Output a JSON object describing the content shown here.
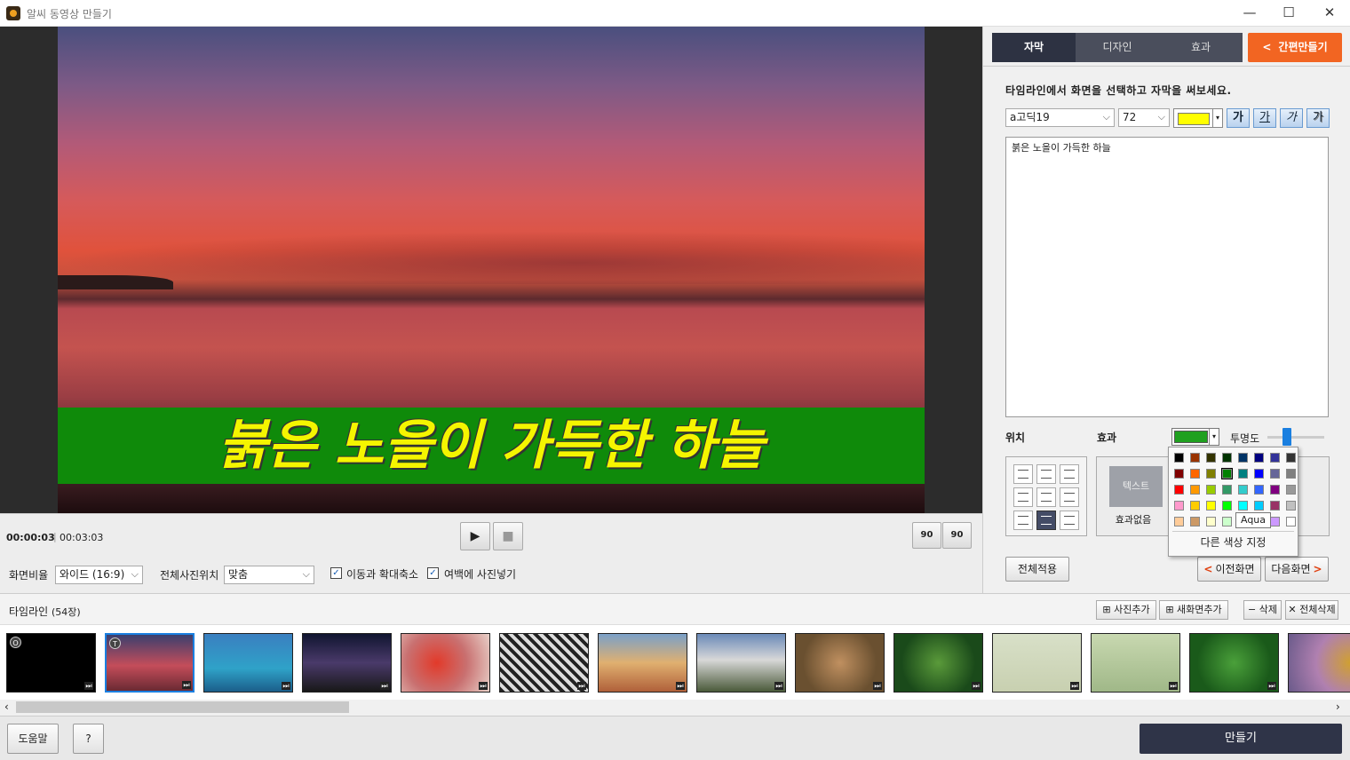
{
  "window": {
    "title": "알씨 동영상 만들기",
    "minimize": "—",
    "maximize": "☐",
    "close": "✕"
  },
  "preview": {
    "caption": "붉은 노을이 가득한 하늘"
  },
  "transport": {
    "current_time": "00:00:03",
    "separator": "|",
    "total_time": "00:03:03",
    "play": "▶",
    "stop": "■",
    "rotate_left": "90",
    "rotate_right": "90"
  },
  "options": {
    "ratio_label": "화면비율",
    "ratio_value": "와이드 (16:9)",
    "photo_pos_label": "전체사진위치",
    "photo_pos_value": "맞춤",
    "pan_zoom_label": "이동과 확대축소",
    "pan_zoom_checked": true,
    "fill_margin_label": "여백에 사진넣기",
    "fill_margin_checked": true,
    "check_mark": "✓"
  },
  "right_panel": {
    "tabs": [
      {
        "label": "자막",
        "active": true
      },
      {
        "label": "디자인",
        "active": false
      },
      {
        "label": "효과",
        "active": false
      }
    ],
    "quick_make": "간편만들기",
    "quick_make_icon": "<",
    "hint": "타임라인에서 화면을 선택하고 자막을 써보세요.",
    "font": "a고딕19",
    "size": "72",
    "text_color": "#ffff00",
    "format_buttons": [
      "가",
      "가",
      "가",
      "가"
    ],
    "caption_text": "붉은 노을이 가득한 하늘",
    "position_label": "위치",
    "effect_label": "효과",
    "effect_color": "#1fa01f",
    "opacity_label": "투명도",
    "opacity_level": 0.35,
    "effect_thumb": "텍스트",
    "effect_none": "효과없음",
    "apply_all": "전체적용",
    "prev_screen": "이전화면",
    "prev_icon": "<",
    "next_screen": "다음화면",
    "next_icon": ">"
  },
  "palette": {
    "colors": [
      [
        "#000000",
        "#993300",
        "#333300",
        "#003300",
        "#003366",
        "#000080",
        "#333399",
        "#333333"
      ],
      [
        "#800000",
        "#ff6600",
        "#808000",
        "#008000",
        "#008080",
        "#0000ff",
        "#666699",
        "#808080"
      ],
      [
        "#ff0000",
        "#ff9900",
        "#99cc00",
        "#339966",
        "#33cccc",
        "#3366ff",
        "#800080",
        "#999999"
      ],
      [
        "#ff99cc",
        "#ffcc00",
        "#ffff00",
        "#00ff00",
        "#00ffff",
        "#00ccff",
        "#993366",
        "#c0c0c0"
      ],
      [
        "#ffcc99",
        "#cc9966",
        "#ffffcc",
        "#ccffcc",
        "#ccffff",
        "#99ccff",
        "#cc99ff",
        "#ffffff"
      ]
    ],
    "selected_index": [
      1,
      3
    ],
    "tooltip": "Aqua",
    "more": "다른 색상 지정"
  },
  "timeline": {
    "label": "타임라인",
    "count": "(54장)",
    "add_photo": "사진추가",
    "add_screen": "새화면추가",
    "delete": "삭제",
    "delete_all": "전체삭제",
    "delete_icon": "−",
    "delete_all_icon": "✕",
    "thumbs": [
      {
        "badge": "O",
        "bg": "#000000"
      },
      {
        "badge": "T",
        "bg": "linear-gradient(#3a3f6e,#c44d5a 55%,#6a2a33)"
      },
      {
        "badge": "",
        "bg": "linear-gradient(#3a7fc0,#2fa2c8 60%,#1b5e8a)"
      },
      {
        "badge": "",
        "bg": "linear-gradient(#101530,#4a3a6a 50%,#181818)"
      },
      {
        "badge": "",
        "bg": "radial-gradient(circle at 40% 50%,#e23a2a,#c97070 50%,#e8d0c8)"
      },
      {
        "badge": "",
        "bg": "repeating-linear-gradient(45deg,#222 0 4px,#ddd 4px 8px)"
      },
      {
        "badge": "",
        "bg": "linear-gradient(#7aa0c8,#e0b070 50%,#b0603a)"
      },
      {
        "badge": "",
        "bg": "linear-gradient(#6a8ab8,#d8d8d8 45%,#4a5a3a)"
      },
      {
        "badge": "",
        "bg": "radial-gradient(circle,#c09060,#6a5030 70%)"
      },
      {
        "badge": "",
        "bg": "radial-gradient(circle,#5a9a3a,#1a4a1a 70%)"
      },
      {
        "badge": "",
        "bg": "linear-gradient(#d8e0c8,#c8d0b0)"
      },
      {
        "badge": "",
        "bg": "linear-gradient(#c8d8b0,#a0b888)"
      },
      {
        "badge": "",
        "bg": "radial-gradient(circle,#4aa03a,#1a5a1a 70%)"
      },
      {
        "badge": "",
        "bg": "radial-gradient(circle at 70% 50%,#d0a030,#b080b0 50%,#6a5a8a)"
      }
    ]
  },
  "footer": {
    "help": "도움말",
    "question": "?",
    "make": "만들기"
  }
}
